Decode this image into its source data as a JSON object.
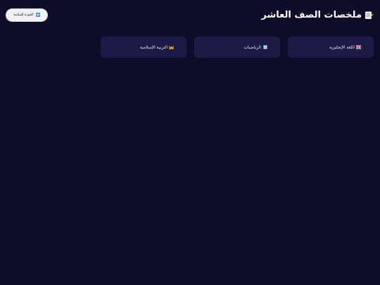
{
  "header": {
    "title": "ملخصات الصف العاشر",
    "title_icon": "memo-pencil-icon",
    "back_button": {
      "label": "العودة للمكتبة",
      "icon": "back-arrow-icon"
    }
  },
  "subjects": [
    {
      "label": "اللغة الإنجليزية",
      "icon": "uk-flag-icon"
    },
    {
      "label": "الرياضيات",
      "icon": "numbers-icon"
    },
    {
      "label": "التربية الإسلامية",
      "icon": "mosque-icon"
    }
  ],
  "colors": {
    "background": "#0e0c28",
    "card": "#1d1b46",
    "button": "#f2f2f4",
    "text": "#ffffff"
  }
}
